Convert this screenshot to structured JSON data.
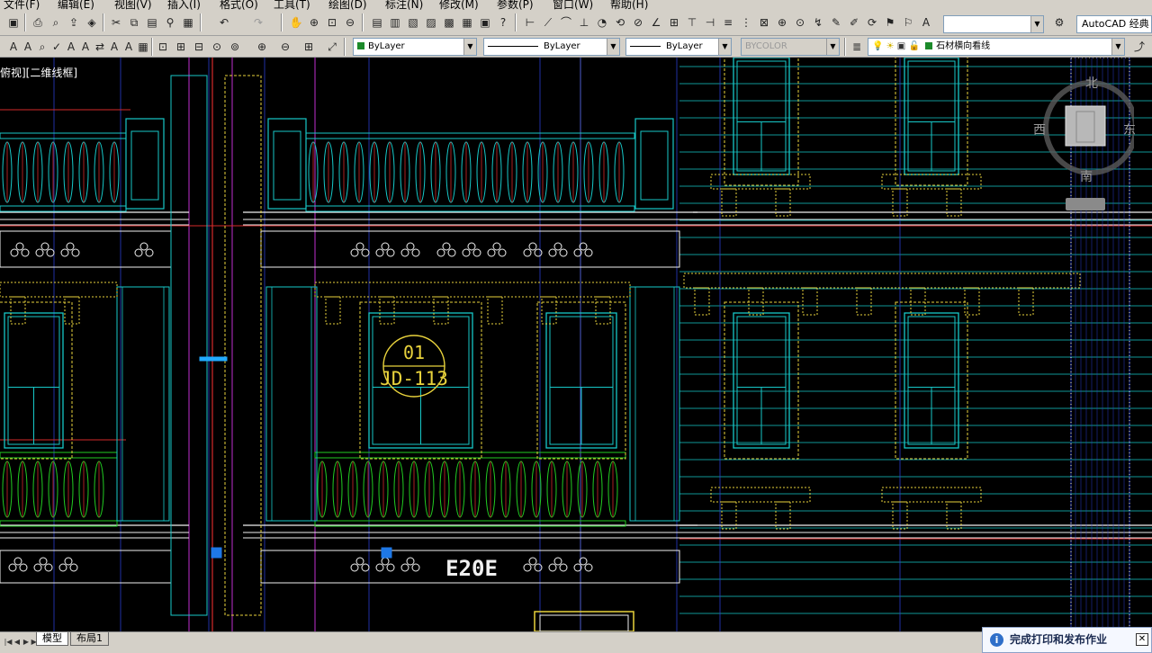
{
  "menu": [
    "文件(F)",
    "编辑(E)",
    "视图(V)",
    "插入(I)",
    "格式(O)",
    "工具(T)",
    "绘图(D)",
    "标注(N)",
    "修改(M)",
    "参数(P)",
    "窗口(W)",
    "帮助(H)"
  ],
  "workspace": "AutoCAD 经典",
  "properties": {
    "color": "ByLayer",
    "linetype": "ByLayer",
    "lineweight": "ByLayer",
    "plotstyle": "BYCOLOR",
    "layer": "石材横向看线"
  },
  "viewport_label": "俯视][二维线框]",
  "viewcube": {
    "north": "北",
    "south": "南",
    "east": "东",
    "west": "西"
  },
  "drawing": {
    "tag_line1": "01",
    "tag_line2": "JD-113",
    "room_number": "E20E"
  },
  "tabs": [
    "模型",
    "布局1"
  ],
  "notification": "完成打印和发布作业",
  "colors": {
    "cyan": "#17c8c8",
    "yellow": "#e8d23c",
    "white": "#f0f0f0",
    "red": "#d42a2a",
    "blue": "#2a3ccc",
    "magenta": "#c030d0",
    "green": "#22cc22",
    "layer_swatch": "#1c8a2a"
  }
}
